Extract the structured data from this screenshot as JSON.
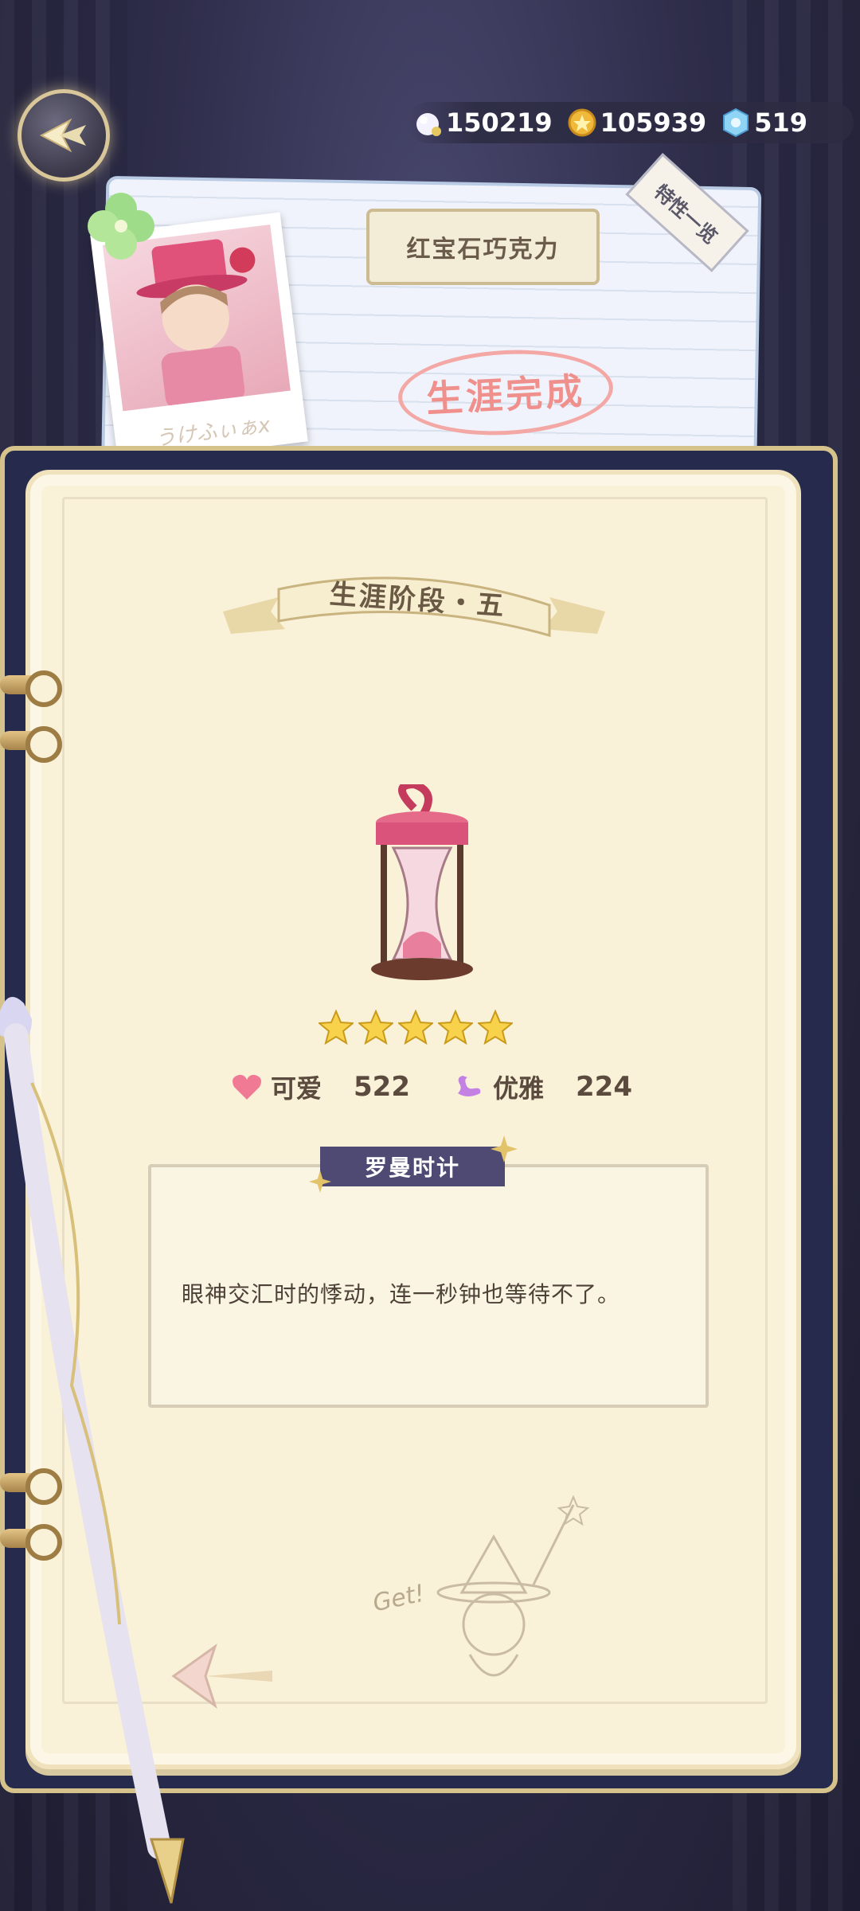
{
  "header": {
    "currencies": [
      {
        "icon": "pearl-icon",
        "value": "150219"
      },
      {
        "icon": "gold-coin-icon",
        "value": "105939"
      },
      {
        "icon": "snow-crystal-icon",
        "value": "519"
      }
    ]
  },
  "card": {
    "title": "红宝石巧克力",
    "traits_tag": "特性一览",
    "status_stamp": "生涯完成",
    "signature": "うけふぃぁx"
  },
  "stage": {
    "label": "生涯阶段・五"
  },
  "item": {
    "stars": 5,
    "stats": [
      {
        "icon": "heart-icon",
        "name": "可爱",
        "value": "522"
      },
      {
        "icon": "swan-icon",
        "name": "优雅",
        "value": "224"
      }
    ],
    "name": "罗曼时计",
    "description": "眼神交汇时的悸动，连一秒钟也等待不了。"
  },
  "doodle": {
    "text": "Get!"
  },
  "colors": {
    "accent": "#4f4a74",
    "page": "#f9f1d8",
    "stamp": "#f0908c",
    "gold": "#d6c28b"
  }
}
